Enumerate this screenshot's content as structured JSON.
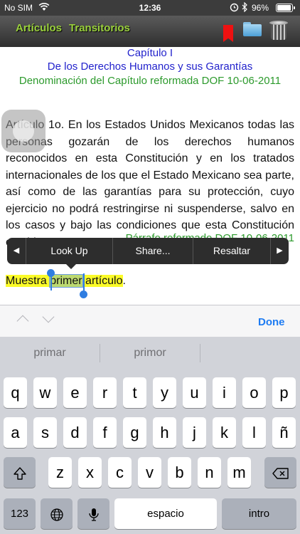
{
  "status_bar": {
    "carrier": "No SIM",
    "time": "12:36",
    "battery_percent": "96%",
    "battery_level": 0.96
  },
  "nav": {
    "title_part1": "Artículos",
    "title_part2": "Transitorios",
    "icons": [
      "bookmark-icon",
      "folder-icon",
      "trash-icon"
    ]
  },
  "document": {
    "chapter": "Capítulo I",
    "chapter_title": "De los Derechos Humanos y sus Garantías",
    "chapter_note": "Denominación del Capítulo reformada DOF 10-06-2011",
    "paragraph": "Artículo 1o. En los Estados Unidos Mexicanos todas las personas gozarán de los derechos humanos reconocidos en esta Constitución y en los tratados internacionales de los que el Estado Mexicano sea parte, así como de las garantías para su protección, cuyo ejercicio no podrá restringirse ni suspenderse, salvo en los casos y bajo las condiciones que esta Constitución establece.",
    "paragraph_note": "Párrafo reformado DOF 10-06-2011",
    "selection_before": "Muestra ",
    "selection_word": "primer",
    "selection_after": " artículo",
    "selection_end": "."
  },
  "edit_menu": {
    "items": [
      "Look Up",
      "Share...",
      "Resaltar"
    ],
    "prev_arrow": "◀",
    "next_arrow": "▶"
  },
  "accessory": {
    "done": "Done"
  },
  "keyboard": {
    "suggestions": [
      "primar",
      "primor",
      ""
    ],
    "row1": [
      "q",
      "w",
      "e",
      "r",
      "t",
      "y",
      "u",
      "i",
      "o",
      "p"
    ],
    "row2": [
      "a",
      "s",
      "d",
      "f",
      "g",
      "h",
      "j",
      "k",
      "l",
      "ñ"
    ],
    "row3": [
      "z",
      "x",
      "c",
      "v",
      "b",
      "n",
      "m"
    ],
    "numbers_key": "123",
    "space_key": "espacio",
    "return_key": "intro",
    "shift_icon": "shift-icon",
    "backspace_icon": "backspace-icon",
    "globe_icon": "globe-icon",
    "mic_icon": "microphone-icon"
  },
  "colors": {
    "nav_title": "#9ad13c",
    "chapter_blue": "#2222cc",
    "note_green": "#2c9a2c",
    "highlight": "#fbfb28",
    "done_blue": "#1e7cf2"
  }
}
